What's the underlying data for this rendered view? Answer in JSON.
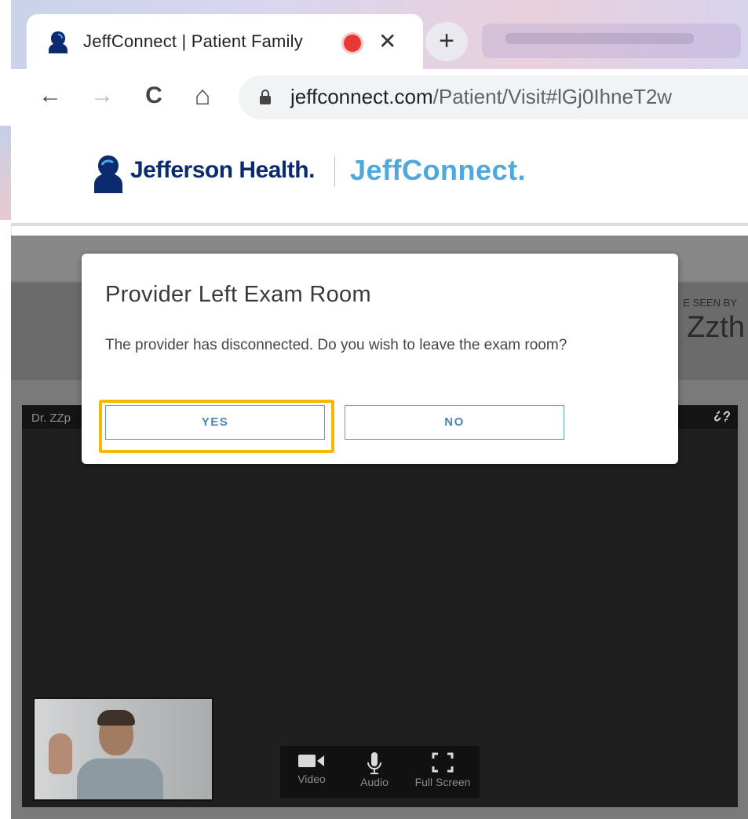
{
  "browser": {
    "tab_title": "JeffConnect | Patient Family",
    "new_tab_symbol": "+",
    "close_symbol": "✕",
    "url_host": "jeffconnect.com",
    "url_path": "/Patient/Visit#lGj0IhneT2w",
    "nav": {
      "back": "←",
      "forward": "→",
      "reload": "C",
      "home": "⌂"
    }
  },
  "header": {
    "brand_primary": "Jefferson Health.",
    "brand_secondary": "JeffConnect."
  },
  "page": {
    "seen_by_label": "E SEEN BY",
    "provider_name_partial": "Zzth",
    "video_name": "Dr. ZZp"
  },
  "controls": {
    "video_label": "Video",
    "audio_label": "Audio",
    "fullscreen_label": "Full Screen"
  },
  "modal": {
    "title": "Provider Left Exam Room",
    "message": "The provider has disconnected. Do you wish to leave the exam room?",
    "yes_label": "YES",
    "no_label": "NO"
  },
  "colors": {
    "highlight": "#f5b700",
    "brand_navy": "#0b2a6f",
    "brand_blue": "#4fa8db",
    "button_border": "#5e9fc8"
  },
  "icons": [
    "tab-favicon-icon",
    "record-icon",
    "close-icon",
    "back-arrow-icon",
    "forward-arrow-icon",
    "reload-icon",
    "home-icon",
    "lock-icon",
    "jefferson-logo-icon",
    "broken-link-icon",
    "video-camera-icon",
    "microphone-icon",
    "fullscreen-icon"
  ]
}
